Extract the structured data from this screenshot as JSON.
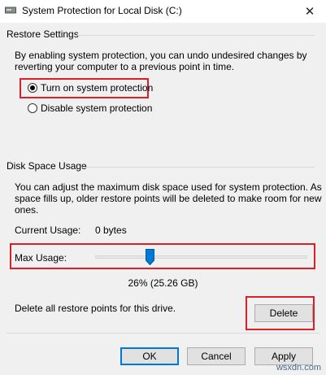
{
  "window": {
    "title": "System Protection for Local Disk (C:)"
  },
  "restore_settings": {
    "heading": "Restore Settings",
    "description_line1": "By enabling system protection, you can undo undesired changes by",
    "description_line2": "reverting your computer to a previous point in time.",
    "options": [
      {
        "label": "Turn on system protection",
        "selected": true
      },
      {
        "label": "Disable system protection",
        "selected": false
      }
    ]
  },
  "disk_space": {
    "heading": "Disk Space Usage",
    "description_line1": "You can adjust the maximum disk space used for system protection. As",
    "description_line2": "space fills up, older restore points will be deleted to make room for new",
    "description_line3": "ones.",
    "current_usage_label": "Current Usage:",
    "current_usage_value": "0 bytes",
    "max_usage_label": "Max Usage:",
    "max_usage_fraction": 0.26,
    "max_usage_readout": "26% (25.26 GB)",
    "delete_text": "Delete all restore points for this drive.",
    "delete_button": "Delete"
  },
  "buttons": {
    "ok": "OK",
    "cancel": "Cancel",
    "apply": "Apply"
  },
  "watermark": "wsxdn.com",
  "colors": {
    "highlight": "#d9202a",
    "slider_thumb": "#0078d7",
    "accent": "#0078d7"
  },
  "icons": {
    "title": "drive-icon",
    "close": "close-icon"
  }
}
